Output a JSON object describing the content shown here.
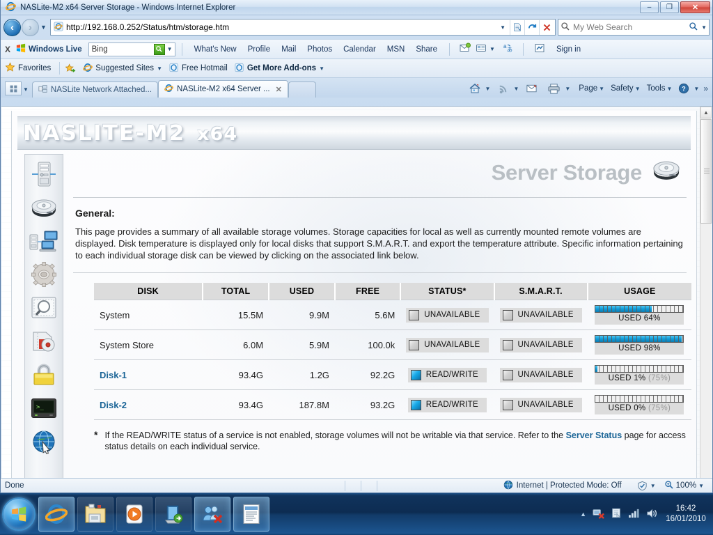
{
  "window": {
    "title": "NASLite-M2 x64 Server Storage - Windows Internet Explorer",
    "minimize_label": "–",
    "restore_label": "❐",
    "close_label": "✕"
  },
  "address_bar": {
    "url_scheme": "http://",
    "url_host": "192.168.0.252",
    "url_path": "/Status/htm/storage.htm",
    "url_full": "http://192.168.0.252/Status/htm/storage.htm",
    "dropdown_label": "▼",
    "compat_label": "compatibility-view",
    "refresh_label": "↻",
    "stop_label": "✕"
  },
  "search_bar": {
    "placeholder": "My Web Search",
    "go_label": "▼"
  },
  "live_bar": {
    "close_label": "X",
    "brand": "Windows Live",
    "search_value": "Bing",
    "search_icon": "search-icon",
    "links": [
      "What's New",
      "Profile",
      "Mail",
      "Photos",
      "Calendar",
      "MSN",
      "Share"
    ],
    "sign_in": "Sign in"
  },
  "favorites_bar": {
    "favorites_label": "Favorites",
    "items": [
      {
        "label": "Suggested Sites",
        "has_caret": true
      },
      {
        "label": "Free Hotmail",
        "has_caret": false
      },
      {
        "label": "Get More Add-ons",
        "has_caret": true
      }
    ]
  },
  "tabs": {
    "quick_tabs_label": "▦",
    "items": [
      {
        "label": "NASLite Network Attached...",
        "active": false,
        "closable": false
      },
      {
        "label": "NASLite-M2 x64 Server ...",
        "active": true,
        "closable": true,
        "close_label": "✕"
      }
    ],
    "commands": [
      "Page",
      "Safety",
      "Tools"
    ],
    "overflow_label": "»",
    "home_icon": "home-icon",
    "feeds_icon": "rss-icon",
    "mail_icon": "mail-icon",
    "print_icon": "printer-icon",
    "help_icon": "help-icon"
  },
  "page": {
    "logo_main": "NASLITE-M2",
    "logo_suffix": "x64",
    "title": "Server Storage",
    "title_icon": "hard-disk-icon",
    "general_heading": "General:",
    "intro": "This page provides a summary of all available storage volumes. Storage capacities for local as well as currently mounted remote volumes are displayed. Disk temperature is displayed only for local disks that support S.M.A.R.T. and export the temperature attribute. Specific information pertaining to each individual storage disk can be viewed by clicking on the associated link below.",
    "sidebar": [
      {
        "name": "server-icon",
        "title": "Server"
      },
      {
        "name": "hard-disk-icon",
        "title": "Storage"
      },
      {
        "name": "network-icon",
        "title": "Network"
      },
      {
        "name": "gear-icon",
        "title": "Configuration"
      },
      {
        "name": "magnifier-icon",
        "title": "Status"
      },
      {
        "name": "disk-burn-icon",
        "title": "Backup"
      },
      {
        "name": "padlock-icon",
        "title": "Security"
      },
      {
        "name": "terminal-icon",
        "title": "Console"
      },
      {
        "name": "globe-icon",
        "title": "Web"
      }
    ],
    "table": {
      "headers": [
        "DISK",
        "TOTAL",
        "USED",
        "FREE",
        "STATUS*",
        "S.M.A.R.T.",
        "USAGE"
      ],
      "rows": [
        {
          "disk": "System",
          "is_link": false,
          "total": "15.5M",
          "used": "9.9M",
          "free": "5.6M",
          "status": "UNAVAILABLE",
          "status_on": false,
          "smart": "UNAVAILABLE",
          "smart_on": false,
          "usage_label": "USED 64%",
          "usage_percent": 64,
          "usage_threshold": ""
        },
        {
          "disk": "System Store",
          "is_link": false,
          "total": "6.0M",
          "used": "5.9M",
          "free": "100.0k",
          "status": "UNAVAILABLE",
          "status_on": false,
          "smart": "UNAVAILABLE",
          "smart_on": false,
          "usage_label": "USED 98%",
          "usage_percent": 98,
          "usage_threshold": ""
        },
        {
          "disk": "Disk-1",
          "is_link": true,
          "total": "93.4G",
          "used": "1.2G",
          "free": "92.2G",
          "status": "READ/WRITE",
          "status_on": true,
          "smart": "UNAVAILABLE",
          "smart_on": false,
          "usage_label": "USED 1%",
          "usage_percent": 1,
          "usage_threshold": "(75%)"
        },
        {
          "disk": "Disk-2",
          "is_link": true,
          "total": "93.4G",
          "used": "187.8M",
          "free": "93.2G",
          "status": "READ/WRITE",
          "status_on": true,
          "smart": "UNAVAILABLE",
          "smart_on": false,
          "usage_label": "USED 0%",
          "usage_percent": 0,
          "usage_threshold": "(75%)"
        }
      ]
    },
    "footnote": {
      "star": "*",
      "text_1": "If the READ/WRITE status of a service is not enabled, storage volumes will not be writable via that service. Refer to the ",
      "link": "Server Status",
      "text_2": " page for access status details on each individual service."
    }
  },
  "status_bar": {
    "status_text": "Done",
    "zone_text": "Internet | Protected Mode: Off",
    "zoom_text": "100%",
    "caret": "▼"
  },
  "taskbar": {
    "start_label": "start-orb",
    "buttons": [
      {
        "name": "taskbar-ie",
        "active": true
      },
      {
        "name": "taskbar-explorer",
        "active": false
      },
      {
        "name": "taskbar-media-player",
        "active": false
      },
      {
        "name": "taskbar-remote-desktop",
        "active": false
      },
      {
        "name": "taskbar-users",
        "active": true
      },
      {
        "name": "taskbar-document",
        "active": true
      }
    ],
    "tray_icons": [
      "network-error-icon",
      "action-center-icon",
      "signal-icon",
      "volume-icon"
    ],
    "overflow_caret": "▲",
    "time": "16:42",
    "date": "16/01/2010"
  },
  "colors": {
    "accent_blue": "#12a0dd",
    "link_blue": "#1a6496",
    "header_gray": "#dcdcdc",
    "title_gray": "#b9bfc4"
  }
}
